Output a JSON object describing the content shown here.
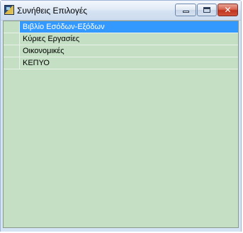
{
  "window": {
    "title": "Συνήθεις Επιλογές",
    "icon": "app-icon",
    "controls": {
      "minimize_icon": "minimize-icon",
      "maximize_icon": "maximize-icon",
      "close_icon": "close-icon",
      "close_glyph": "✕"
    }
  },
  "list": {
    "selected_index": 0,
    "items": [
      {
        "label": "Βιβλίο Εσόδων-Εξόδων"
      },
      {
        "label": "Κύριες Εργασίες"
      },
      {
        "label": "Οικονομικές"
      },
      {
        "label": "ΚΕΠΥΟ"
      }
    ]
  },
  "colors": {
    "list_background": "#c4dfc3",
    "selection": "#3399ff",
    "close_button": "#c0341e"
  }
}
